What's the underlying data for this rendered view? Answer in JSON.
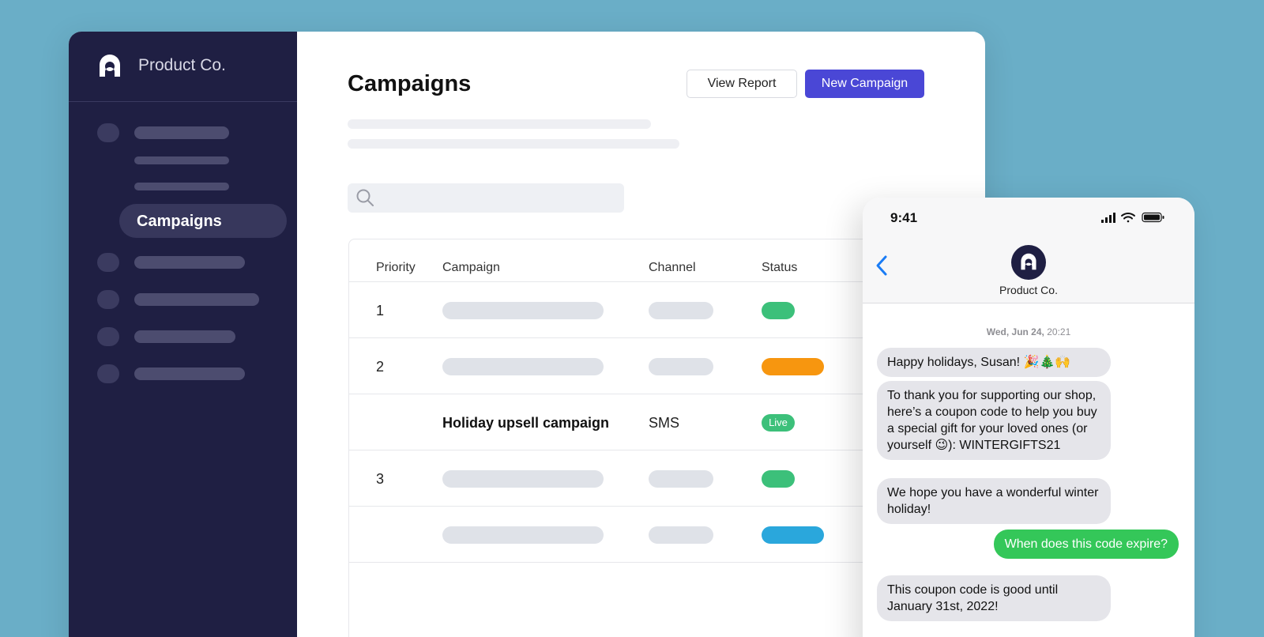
{
  "app": {
    "brand_name": "Product Co.",
    "page_title": "Campaigns",
    "buttons": {
      "view_report": "View Report",
      "new_campaign": "New Campaign"
    },
    "sidebar": {
      "active_item": "Campaigns"
    },
    "search": {
      "placeholder": ""
    },
    "table": {
      "headers": [
        "Priority",
        "Campaign",
        "Channel",
        "Status"
      ],
      "rows": [
        {
          "priority": "1",
          "status_color": "#3cc07a"
        },
        {
          "priority": "2",
          "status_color": "#f7960f"
        },
        {
          "priority": "",
          "campaign": "Holiday upsell campaign",
          "channel": "SMS",
          "status": "Live",
          "status_color": "#3cc07a"
        },
        {
          "priority": "3",
          "status_color": "#3cc07a"
        },
        {
          "priority": "",
          "status_color": "#2aa7dc"
        }
      ]
    },
    "colors": {
      "primary": "#4a47d6",
      "sidebar": "#1f1f43"
    }
  },
  "phone": {
    "time": "9:41",
    "contact_name": "Product Co.",
    "date_day": "Wed, Jun 24,",
    "date_time": "20:21",
    "messages": [
      {
        "from": "them",
        "text": "Happy holidays, Susan! 🎉🎄🙌"
      },
      {
        "from": "them",
        "text": "To thank you for supporting our shop, here’s a coupon code to help you buy a special gift for your loved ones (or yourself 😉): WINTERGIFTS21"
      },
      {
        "from": "them",
        "text": "We hope you have a wonderful winter holiday!"
      },
      {
        "from": "me",
        "text": "When does this code expire?"
      },
      {
        "from": "them",
        "text": "This coupon code is good until January 31st, 2022!"
      }
    ]
  }
}
